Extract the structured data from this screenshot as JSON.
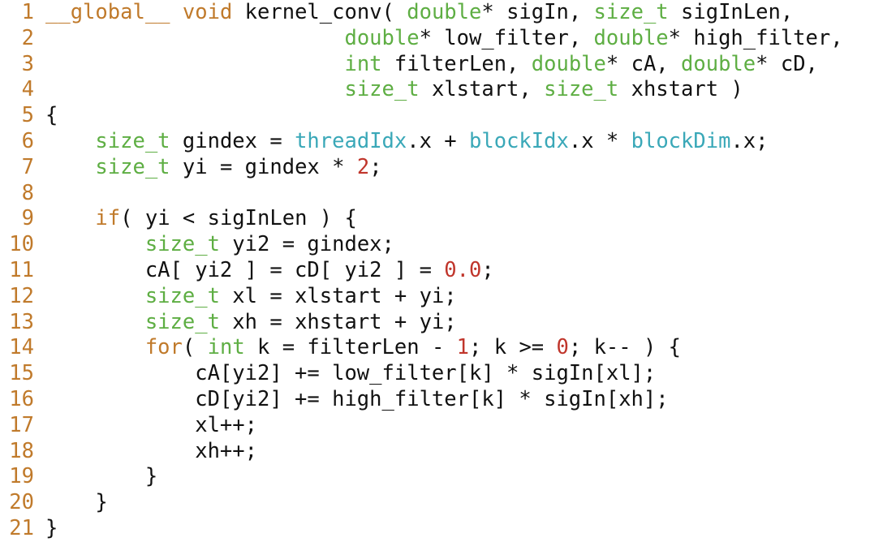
{
  "editor": {
    "colors": {
      "keyword": "#c07a2b",
      "type": "#5eae43",
      "builtin": "#3aa8b8",
      "number": "#c0352b",
      "text": "#111111",
      "line_number": "#c07a2b",
      "background": "#ffffff"
    },
    "lines": [
      {
        "num": "1",
        "tokens": [
          {
            "t": "__global__",
            "c": "kw"
          },
          {
            "t": " ",
            "c": "plain"
          },
          {
            "t": "void",
            "c": "kw"
          },
          {
            "t": " kernel_conv( ",
            "c": "plain"
          },
          {
            "t": "double",
            "c": "type"
          },
          {
            "t": "* sigIn, ",
            "c": "plain"
          },
          {
            "t": "size_t",
            "c": "type"
          },
          {
            "t": " sigInLen,",
            "c": "plain"
          }
        ]
      },
      {
        "num": "2",
        "tokens": [
          {
            "t": "                        ",
            "c": "plain"
          },
          {
            "t": "double",
            "c": "type"
          },
          {
            "t": "* low_filter, ",
            "c": "plain"
          },
          {
            "t": "double",
            "c": "type"
          },
          {
            "t": "* high_filter,",
            "c": "plain"
          }
        ]
      },
      {
        "num": "3",
        "tokens": [
          {
            "t": "                        ",
            "c": "plain"
          },
          {
            "t": "int",
            "c": "type"
          },
          {
            "t": " filterLen, ",
            "c": "plain"
          },
          {
            "t": "double",
            "c": "type"
          },
          {
            "t": "* cA, ",
            "c": "plain"
          },
          {
            "t": "double",
            "c": "type"
          },
          {
            "t": "* cD,",
            "c": "plain"
          }
        ]
      },
      {
        "num": "4",
        "tokens": [
          {
            "t": "                        ",
            "c": "plain"
          },
          {
            "t": "size_t",
            "c": "type"
          },
          {
            "t": " xlstart, ",
            "c": "plain"
          },
          {
            "t": "size_t",
            "c": "type"
          },
          {
            "t": " xhstart )",
            "c": "plain"
          }
        ]
      },
      {
        "num": "5",
        "tokens": [
          {
            "t": "{",
            "c": "plain"
          }
        ]
      },
      {
        "num": "6",
        "tokens": [
          {
            "t": "    ",
            "c": "plain"
          },
          {
            "t": "size_t",
            "c": "type"
          },
          {
            "t": " gindex = ",
            "c": "plain"
          },
          {
            "t": "threadIdx",
            "c": "builtin"
          },
          {
            "t": ".x + ",
            "c": "plain"
          },
          {
            "t": "blockIdx",
            "c": "builtin"
          },
          {
            "t": ".x * ",
            "c": "plain"
          },
          {
            "t": "blockDim",
            "c": "builtin"
          },
          {
            "t": ".x;",
            "c": "plain"
          }
        ]
      },
      {
        "num": "7",
        "tokens": [
          {
            "t": "    ",
            "c": "plain"
          },
          {
            "t": "size_t",
            "c": "type"
          },
          {
            "t": " yi = gindex * ",
            "c": "plain"
          },
          {
            "t": "2",
            "c": "num"
          },
          {
            "t": ";",
            "c": "plain"
          }
        ]
      },
      {
        "num": "8",
        "tokens": []
      },
      {
        "num": "9",
        "tokens": [
          {
            "t": "    ",
            "c": "plain"
          },
          {
            "t": "if",
            "c": "kw"
          },
          {
            "t": "( yi < sigInLen ) {",
            "c": "plain"
          }
        ]
      },
      {
        "num": "10",
        "tokens": [
          {
            "t": "        ",
            "c": "plain"
          },
          {
            "t": "size_t",
            "c": "type"
          },
          {
            "t": " yi2 = gindex;",
            "c": "plain"
          }
        ]
      },
      {
        "num": "11",
        "tokens": [
          {
            "t": "        cA[ yi2 ] = cD[ yi2 ] = ",
            "c": "plain"
          },
          {
            "t": "0.0",
            "c": "num"
          },
          {
            "t": ";",
            "c": "plain"
          }
        ]
      },
      {
        "num": "12",
        "tokens": [
          {
            "t": "        ",
            "c": "plain"
          },
          {
            "t": "size_t",
            "c": "type"
          },
          {
            "t": " xl = xlstart + yi;",
            "c": "plain"
          }
        ]
      },
      {
        "num": "13",
        "tokens": [
          {
            "t": "        ",
            "c": "plain"
          },
          {
            "t": "size_t",
            "c": "type"
          },
          {
            "t": " xh = xhstart + yi;",
            "c": "plain"
          }
        ]
      },
      {
        "num": "14",
        "tokens": [
          {
            "t": "        ",
            "c": "plain"
          },
          {
            "t": "for",
            "c": "kw"
          },
          {
            "t": "( ",
            "c": "plain"
          },
          {
            "t": "int",
            "c": "type"
          },
          {
            "t": " k = filterLen - ",
            "c": "plain"
          },
          {
            "t": "1",
            "c": "num"
          },
          {
            "t": "; k >= ",
            "c": "plain"
          },
          {
            "t": "0",
            "c": "num"
          },
          {
            "t": "; k-- ) {",
            "c": "plain"
          }
        ]
      },
      {
        "num": "15",
        "tokens": [
          {
            "t": "            cA[yi2] += low_filter[k] * sigIn[xl];",
            "c": "plain"
          }
        ]
      },
      {
        "num": "16",
        "tokens": [
          {
            "t": "            cD[yi2] += high_filter[k] * sigIn[xh];",
            "c": "plain"
          }
        ]
      },
      {
        "num": "17",
        "tokens": [
          {
            "t": "            xl++;",
            "c": "plain"
          }
        ]
      },
      {
        "num": "18",
        "tokens": [
          {
            "t": "            xh++;",
            "c": "plain"
          }
        ]
      },
      {
        "num": "19",
        "tokens": [
          {
            "t": "        }",
            "c": "plain"
          }
        ]
      },
      {
        "num": "20",
        "tokens": [
          {
            "t": "    }",
            "c": "plain"
          }
        ]
      },
      {
        "num": "21",
        "tokens": [
          {
            "t": "}",
            "c": "plain"
          }
        ]
      }
    ]
  }
}
